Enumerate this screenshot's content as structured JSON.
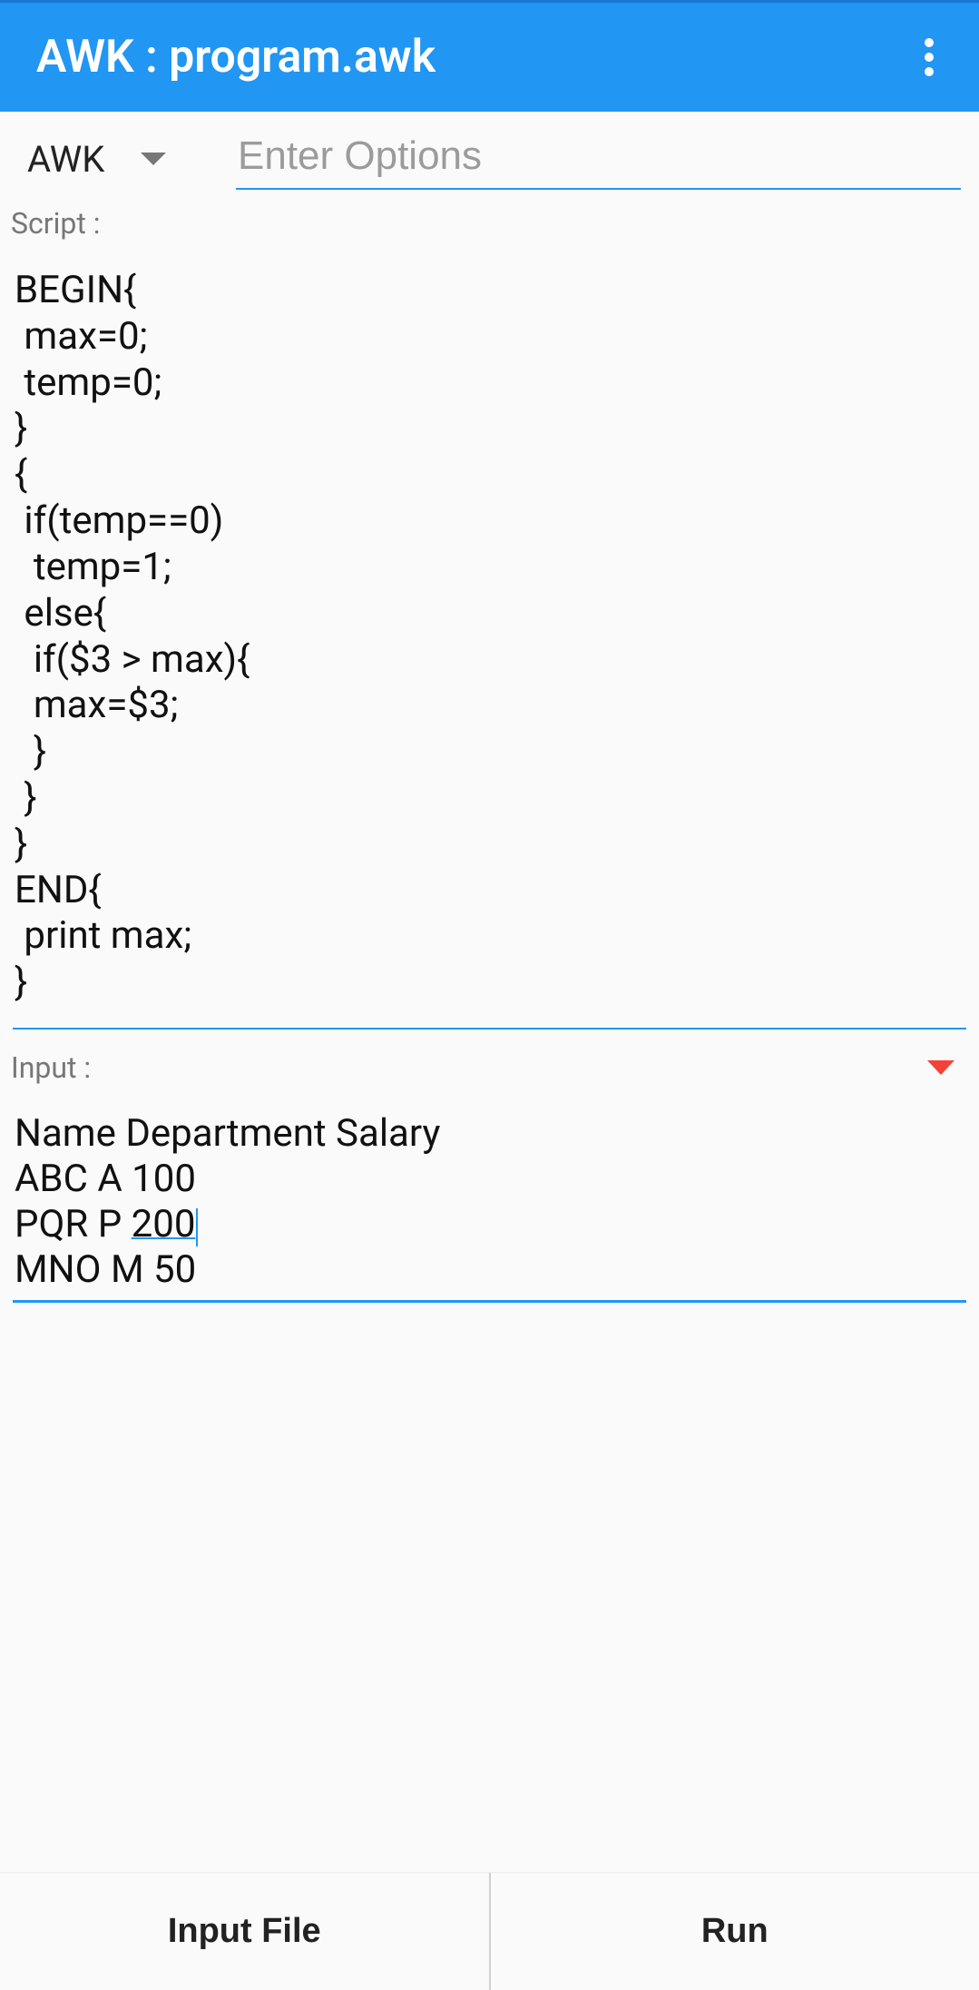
{
  "header": {
    "title": "AWK : program.awk"
  },
  "controls": {
    "language": "AWK",
    "options_placeholder": "Enter Options",
    "options_value": ""
  },
  "script": {
    "label": "Script :",
    "content": "BEGIN{\n max=0;\n temp=0;\n}\n{\n if(temp==0)\n  temp=1;\n else{\n  if($3 > max){\n  max=$3;\n  }\n }\n}\nEND{\n print max;\n}"
  },
  "input": {
    "label": "Input :",
    "line1": "Name Department Salary",
    "line2": "ABC A 100",
    "line3_prefix": "PQR P ",
    "line3_underlined": "200",
    "line4": "MNO M 50"
  },
  "bottom": {
    "input_file": "Input File",
    "run": "Run"
  }
}
